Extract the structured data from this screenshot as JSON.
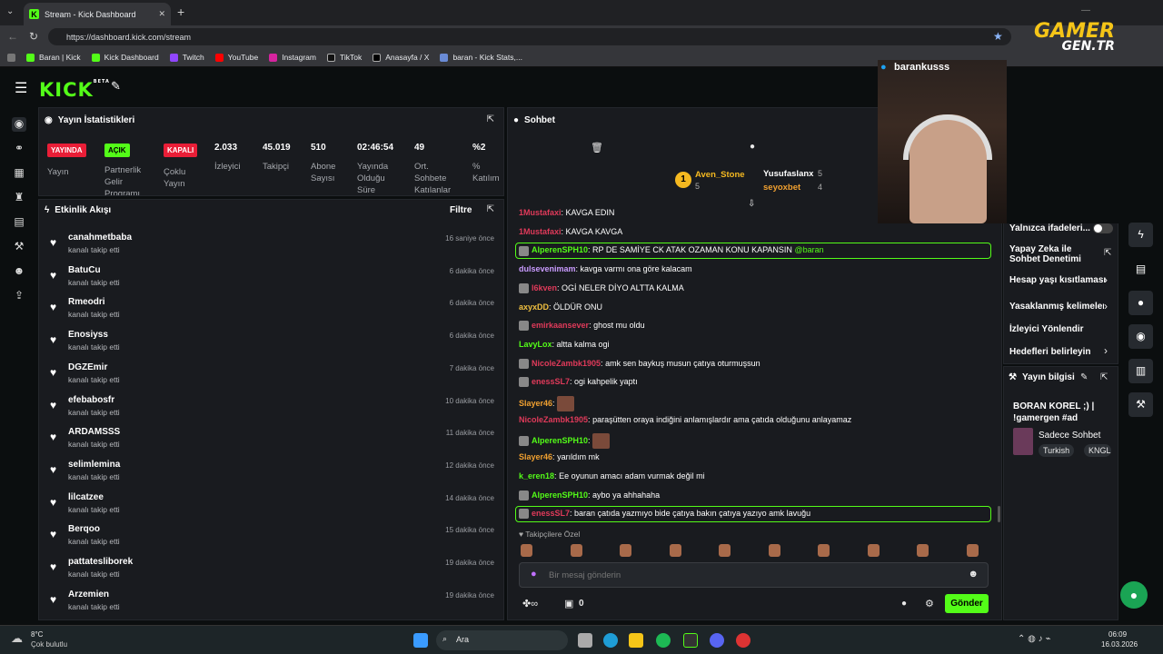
{
  "browser": {
    "tab_title": "Stream - Kick Dashboard",
    "url": "https://dashboard.kick.com/stream",
    "bookmarks": [
      "Baran | Kick",
      "Kick Dashboard",
      "Twitch",
      "YouTube",
      "Instagram",
      "TikTok",
      "Anasayfa / X",
      "baran - Kick Stats,..."
    ]
  },
  "watermark": {
    "line1": "GAMER",
    "line2": "GEN.TR"
  },
  "app": {
    "logo": "KICK",
    "logo_badge": "BETA"
  },
  "stats": {
    "title": "Yayın İstatistikleri",
    "badges": [
      {
        "badge": "YAYINDA",
        "label": "Yayın",
        "color": "#e91e37"
      },
      {
        "badge": "AÇIK",
        "label": "Partnerlik Gelir Programı",
        "color": "#53fc18"
      },
      {
        "badge": "KAPALI",
        "label": "Çoklu Yayın",
        "color": "#e91e37"
      }
    ],
    "values": [
      {
        "value": "2.033",
        "label": "İzleyici"
      },
      {
        "value": "45.019",
        "label": "Takipçi"
      },
      {
        "value": "510",
        "label": "Abone Sayısı"
      },
      {
        "value": "02:46:54",
        "label": "Yayında Olduğu Süre"
      },
      {
        "value": "49",
        "label": "Ort. Sohbete Katılanlar"
      },
      {
        "value": "%2",
        "label": "% Katılım"
      }
    ]
  },
  "activity": {
    "title": "Etkinlik Akışı",
    "filter": "Filtre",
    "sub": "kanalı takip etti",
    "items": [
      {
        "name": "canahmetbaba",
        "time": "16 saniye önce"
      },
      {
        "name": "BatuCu",
        "time": "6 dakika önce"
      },
      {
        "name": "Rmeodri",
        "time": "6 dakika önce"
      },
      {
        "name": "Enosiyss",
        "time": "6 dakika önce"
      },
      {
        "name": "DGZEmir",
        "time": "7 dakika önce"
      },
      {
        "name": "efebabosfr",
        "time": "10 dakika önce"
      },
      {
        "name": "ARDAMSSS",
        "time": "11 dakika önce"
      },
      {
        "name": "selimlemina",
        "time": "12 dakika önce"
      },
      {
        "name": "lilcatzee",
        "time": "14 dakika önce"
      },
      {
        "name": "Berqoo",
        "time": "15 dakika önce"
      },
      {
        "name": "pattatesliborek",
        "time": "19 dakika önce"
      },
      {
        "name": "Arzemien",
        "time": "19 dakika önce"
      }
    ]
  },
  "chat": {
    "title": "Sohbet",
    "leaders": [
      {
        "name": "Aven_Stone",
        "count": "5"
      },
      {
        "name": "Yusufaslanx",
        "count": "5"
      },
      {
        "name": "seyoxbet",
        "count": "4"
      }
    ],
    "messages": [
      {
        "user": "1Mustafaxi",
        "text": "KAVGA EDIN",
        "color": "#e03a5a"
      },
      {
        "user": "1Mustafaxi",
        "text": "KAVGA KAVGA",
        "color": "#e03a5a"
      },
      {
        "user": "AlperenSPH10",
        "text": "RP DE SAMİYE CK ATAK OZAMAN KONU KAPANSIN",
        "mention": "@baran",
        "color": "#53fc18"
      },
      {
        "user": "dulsevenimam",
        "text": "kavga varmı ona göre kalacam",
        "color": "#c99bff"
      },
      {
        "user": "l6kven",
        "text": "OGİ NELER DİYO ALTTA KALMA",
        "color": "#e03a5a"
      },
      {
        "user": "axyxDD",
        "text": "ÖLDÜR ONU",
        "color": "#f0c040"
      },
      {
        "user": "emirkaansever",
        "text": "ghost mu oldu",
        "color": "#e03a5a"
      },
      {
        "user": "LavyLox",
        "text": "altta kalma ogi",
        "color": "#53fc18"
      },
      {
        "user": "NicoleZambk1905",
        "text": "amk sen baykuş musun çatıya oturmuşsun",
        "color": "#e03a5a"
      },
      {
        "user": "enessSL7",
        "text": "ogi kahpelik yaptı",
        "color": "#e03a5a"
      },
      {
        "user": "Slayer46",
        "text": "",
        "color": "#f0a030"
      },
      {
        "user": "NicoleZambk1905",
        "text": "paraşütten oraya indiğini anlamışlardır ama çatıda olduğunu anlayamaz",
        "color": "#e03a5a"
      },
      {
        "user": "AlperenSPH10",
        "text": "",
        "color": "#53fc18"
      },
      {
        "user": "Slayer46",
        "text": "yarıldım mk",
        "color": "#f0a030"
      },
      {
        "user": "k_eren18",
        "text": "Ee oyunun amacı adam vurmak değil mi",
        "color": "#53fc18"
      },
      {
        "user": "AlperenSPH10",
        "text": "aybo ya ahhahaha",
        "color": "#53fc18"
      },
      {
        "user": "enessSL7",
        "text": "baran çatıda yazmıyo bide çatıya bakın çatıya yazıyo amk lavuğu",
        "color": "#e03a5a"
      }
    ],
    "followers_label": "Takipçilere Özel",
    "input_placeholder": "Bir mesaj gönderin",
    "points": "0",
    "send_label": "Gönder"
  },
  "moderation": {
    "items": [
      "Yalnızca ifadeleri...",
      "Yapay Zeka ile Sohbet Denetimi",
      "Hesap yaşı kısıtlaması",
      "Yasaklanmış kelimeler",
      "İzleyici Yönlendir",
      "Hedefleri belirleyin"
    ]
  },
  "streaminfo": {
    "title": "Yayın bilgisi",
    "stream_title": "BORAN KOREL ;) | !gamergen #ad",
    "category": "Sadece Sohbet",
    "tags": [
      "Turkish",
      "KNGL"
    ]
  },
  "webcam": {
    "handle": "barankusss"
  },
  "taskbar": {
    "temp": "8°C",
    "weather": "Çok bulutlu",
    "search": "Ara",
    "time": "06:09",
    "date": "16.03.2026"
  }
}
